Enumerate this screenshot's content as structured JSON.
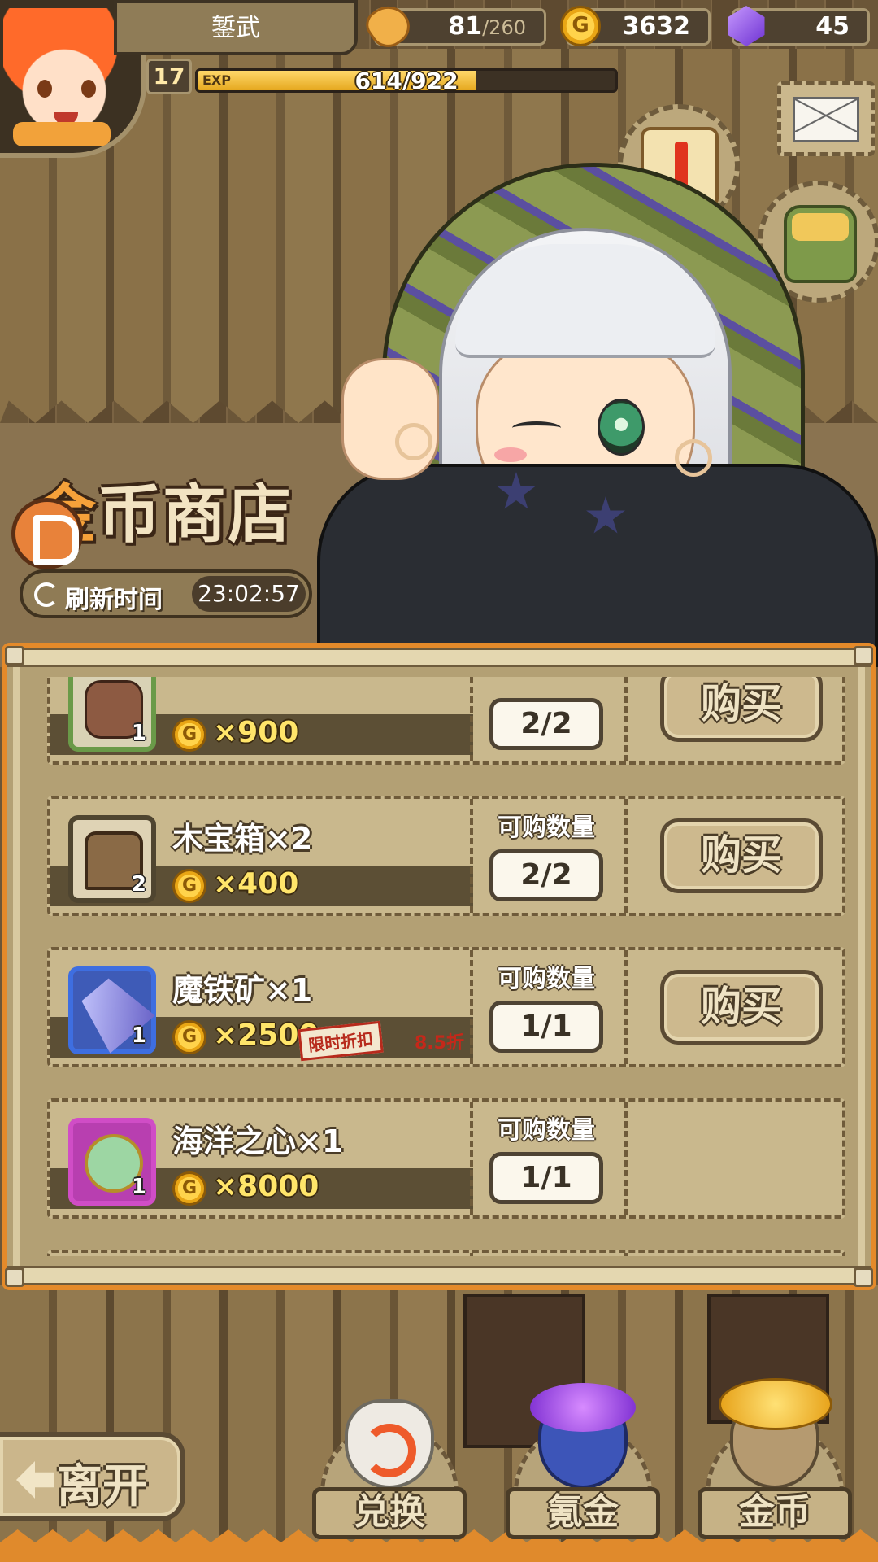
{
  "player": {
    "name": "錾武",
    "level": "17",
    "exp_label": "EXP",
    "exp_text": "614/922",
    "exp_fraction": 0.666
  },
  "resources": {
    "stamina_value": "81",
    "stamina_max": "/260",
    "gold": "3632",
    "gems": "45",
    "coin_glyph": "G"
  },
  "shop": {
    "title_first": "金",
    "title_rest": "币商店",
    "refresh_label": "刷新时间",
    "refresh_time": "23:02:57",
    "limit_label": "可购数量",
    "buy_label": "购买",
    "items": [
      {
        "name": "",
        "qty": "1",
        "price": "×900",
        "limit": "2/2",
        "frame": "green",
        "art": "boots"
      },
      {
        "name": "木宝箱×2",
        "qty": "2",
        "price": "×400",
        "limit": "2/2",
        "frame": "plain",
        "art": "chest"
      },
      {
        "name": "魔铁矿×1",
        "qty": "1",
        "price": "×2500",
        "limit": "1/1",
        "frame": "blue",
        "art": "ore",
        "discount_tag": "限时折扣",
        "discount_rate": "8.5折"
      },
      {
        "name": "海洋之心×1",
        "qty": "1",
        "price": "×8000",
        "limit": "1/1",
        "frame": "purple",
        "art": "heart"
      },
      {
        "name": "",
        "qty": "",
        "price": "",
        "limit": "",
        "frame": "blue",
        "art": "ore"
      }
    ]
  },
  "nav": {
    "leave_label": "离开",
    "exchange_label": "兑换",
    "krypton_label": "氪金",
    "gold_label": "金币"
  },
  "colors": {
    "panel_border": "#e48a2a",
    "gold_text": "#ffe56a",
    "discount_red": "#b72a1c"
  }
}
